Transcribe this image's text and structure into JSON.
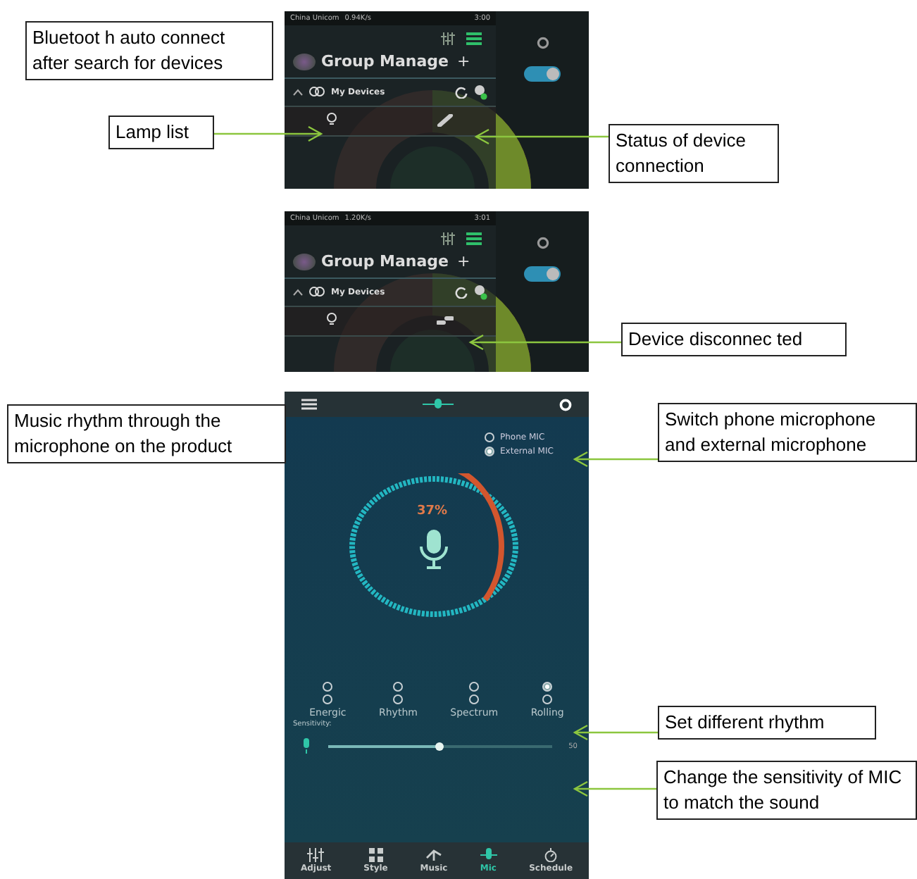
{
  "callouts": [
    {
      "text": "Bluetoot h auto connect after search for devices",
      "kind": "box"
    },
    {
      "text": "Lamp list",
      "kind": "arrow-right"
    },
    {
      "text": "Status of device connection",
      "kind": "arrow-left"
    },
    {
      "text": "Device disconnec ted",
      "kind": "arrow-left"
    },
    {
      "text": "Music rhythm through the microphone on the product",
      "kind": "box"
    },
    {
      "text": "Switch phone microphone and external microphone",
      "kind": "arrow-left"
    },
    {
      "text": "Set different rhythm",
      "kind": "arrow-left"
    },
    {
      "text": "Change the sensitivity of MIC to match the sound",
      "kind": "arrow-left"
    }
  ],
  "device_screens": [
    {
      "status_bar": {
        "carrier": "China Unicom",
        "speed": "0.94K/s",
        "time": "3:00"
      },
      "title": "Group Manage",
      "add": "+",
      "power_on": true,
      "section": "My Devices",
      "expanded": true,
      "device_connected": true
    },
    {
      "status_bar": {
        "carrier": "China Unicom",
        "speed": "1.20K/s",
        "time": "3:01"
      },
      "title": "Group Manage",
      "add": "+",
      "power_on": true,
      "section": "My Devices",
      "expanded": true,
      "device_connected": false
    }
  ],
  "mic_screen": {
    "sources": [
      {
        "label": "Phone MIC",
        "selected": false
      },
      {
        "label": "External MIC",
        "selected": true
      }
    ],
    "volume": {
      "level": 0.37,
      "reading": "37%"
    },
    "modes": [
      {
        "label": "Energic",
        "selected": false
      },
      {
        "label": "Rhythm",
        "selected": false
      },
      {
        "label": "Spectrum",
        "selected": false
      },
      {
        "label": "Rolling",
        "selected": true
      }
    ],
    "sensitivity": {
      "label": "Sensitivity:",
      "level": 0.5,
      "reading": "50"
    },
    "nav": [
      {
        "label": "Adjust",
        "kind": "sliders",
        "selected": false
      },
      {
        "label": "Style",
        "kind": "grid",
        "selected": false
      },
      {
        "label": "Music",
        "kind": "note",
        "selected": false
      },
      {
        "label": "Mic",
        "kind": "mic",
        "selected": true
      },
      {
        "label": "Schedule",
        "kind": "timer",
        "selected": false
      }
    ]
  }
}
